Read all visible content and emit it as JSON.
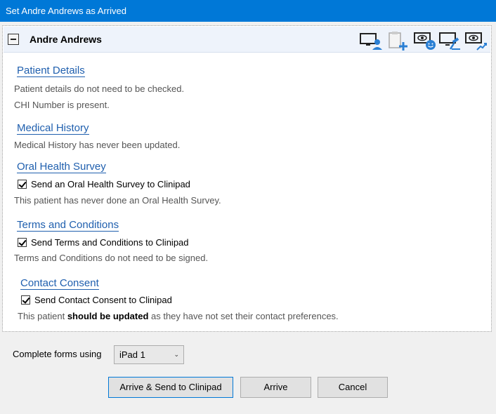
{
  "window": {
    "title": "Set Andre Andrews as Arrived"
  },
  "patient": {
    "name": "Andre Andrews"
  },
  "header_icons": [
    "patient-screen-icon",
    "add-clipboard-icon",
    "view-face-icon",
    "screen-gavel-icon",
    "view-chart-icon"
  ],
  "sections": {
    "patient_details": {
      "title": "Patient Details",
      "line1": "Patient details do not need to be checked.",
      "line2": "CHI Number is present."
    },
    "medical_history": {
      "title": "Medical History",
      "line1": "Medical History has never been updated."
    },
    "oral_health": {
      "title": "Oral Health Survey",
      "checkbox": "Send an Oral Health Survey to Clinipad",
      "checked": true,
      "line1": "This patient has never done an Oral Health Survey."
    },
    "terms": {
      "title": "Terms and Conditions",
      "checkbox": "Send Terms and Conditions to Clinipad",
      "checked": true,
      "line1": "Terms and Conditions do not need to be signed."
    },
    "contact": {
      "title": "Contact Consent",
      "checkbox": "Send Contact Consent to Clinipad",
      "checked": true,
      "line_pre": "This patient ",
      "line_bold": "should be updated",
      "line_post": " as they have not set their contact preferences."
    }
  },
  "complete_forms": {
    "label": "Complete forms using",
    "value": "iPad 1"
  },
  "buttons": {
    "arrive_send": "Arrive & Send to Clinipad",
    "arrive": "Arrive",
    "cancel": "Cancel"
  },
  "colors": {
    "titlebar": "#0078d7",
    "link": "#1f5fae",
    "icon_blue": "#2a7fd4"
  }
}
